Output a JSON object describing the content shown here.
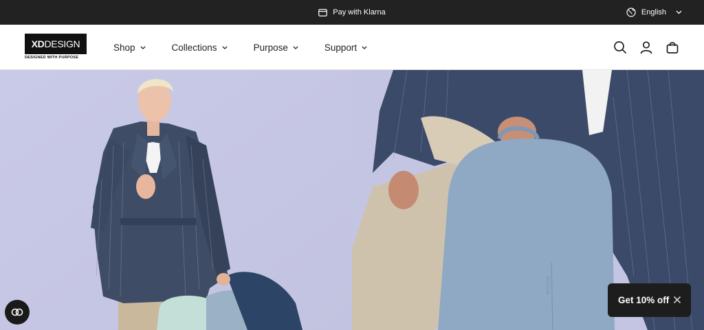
{
  "announcement": {
    "text": "Pay with Klarna",
    "icon": "card-icon"
  },
  "language": {
    "label": "English",
    "icon": "globe-icon"
  },
  "logo": {
    "brand_bold": "XD",
    "brand_thin": "DESIGN",
    "tagline": "DESIGNED WITH PURPOSE"
  },
  "nav": {
    "items": [
      {
        "label": "Shop"
      },
      {
        "label": "Collections"
      },
      {
        "label": "Purpose"
      },
      {
        "label": "Support"
      }
    ]
  },
  "header_icons": [
    "search-icon",
    "account-icon",
    "bag-icon"
  ],
  "hero": {
    "left_image": "woman in denim trench coat holding backpacks",
    "right_image": "seated person holding light blue backpack",
    "bag_label": "XD DESIGN"
  },
  "discount": {
    "label": "Get 10% off"
  },
  "colors": {
    "topbar": "#222222",
    "hero_bg": "#c7c8e6",
    "coat": "#3e4c66",
    "bag_blue": "#8fa9c4"
  }
}
